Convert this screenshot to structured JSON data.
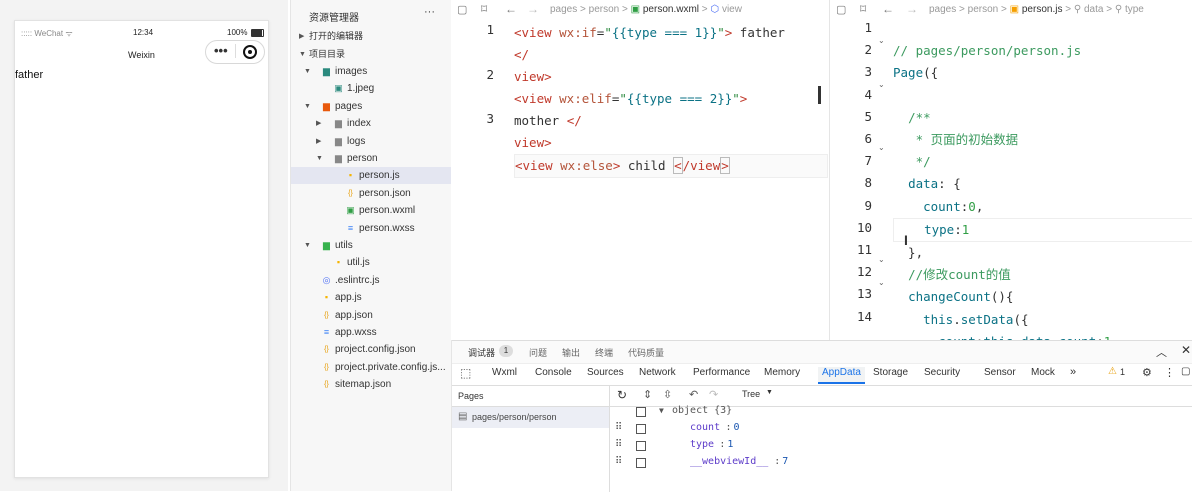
{
  "simulator": {
    "status_left": "WeChat",
    "status_time": "12:34",
    "status_battery": "100%",
    "nav_title": "Weixin",
    "page_text": "father"
  },
  "explorer": {
    "title": "资源管理器",
    "more": "···",
    "section_open": "打开的编辑器",
    "section_project": "项目目录",
    "items": [
      {
        "label": "images",
        "type": "folder",
        "depth": 1,
        "open": true
      },
      {
        "label": "1.jpeg",
        "type": "image",
        "depth": 2
      },
      {
        "label": "pages",
        "type": "folder",
        "depth": 1,
        "open": true
      },
      {
        "label": "index",
        "type": "folder",
        "depth": 2,
        "open": false
      },
      {
        "label": "logs",
        "type": "folder",
        "depth": 2,
        "open": false
      },
      {
        "label": "person",
        "type": "folder",
        "depth": 2,
        "open": true
      },
      {
        "label": "person.js",
        "type": "js",
        "depth": 3,
        "selected": true
      },
      {
        "label": "person.json",
        "type": "json",
        "depth": 3
      },
      {
        "label": "person.wxml",
        "type": "wxml",
        "depth": 3
      },
      {
        "label": "person.wxss",
        "type": "wxss",
        "depth": 3
      },
      {
        "label": "utils",
        "type": "folder",
        "depth": 1,
        "open": true
      },
      {
        "label": "util.js",
        "type": "js",
        "depth": 2
      },
      {
        "label": ".eslintrc.js",
        "type": "eslint",
        "depth": 1
      },
      {
        "label": "app.js",
        "type": "js",
        "depth": 1
      },
      {
        "label": "app.json",
        "type": "json",
        "depth": 1
      },
      {
        "label": "app.wxss",
        "type": "wxss",
        "depth": 1
      },
      {
        "label": "project.config.json",
        "type": "json",
        "depth": 1
      },
      {
        "label": "project.private.config.js...",
        "type": "json",
        "depth": 1
      },
      {
        "label": "sitemap.json",
        "type": "json",
        "depth": 1
      }
    ]
  },
  "wxml_editor": {
    "breadcrumb": [
      "pages",
      "person",
      "person.wxml",
      "view"
    ],
    "line_numbers": [
      "1",
      "2",
      "3"
    ]
  },
  "js_editor": {
    "breadcrumb": [
      "pages",
      "person",
      "person.js",
      "data",
      "type"
    ],
    "line_numbers": [
      "1",
      "2",
      "3",
      "4",
      "5",
      "6",
      "7",
      "8",
      "9",
      "10",
      "11",
      "12",
      "13",
      "14"
    ]
  },
  "devtools": {
    "top_tabs": [
      "调试器",
      "问题",
      "输出",
      "终端",
      "代码质量"
    ],
    "badge": "1",
    "tabs": [
      "Wxml",
      "Console",
      "Sources",
      "Network",
      "Performance",
      "Memory",
      "AppData",
      "Storage",
      "Security",
      "Sensor",
      "Mock"
    ],
    "active_tab": "AppData",
    "warning_count": "1",
    "pages_header": "Pages",
    "page_path": "pages/person/person",
    "view_mode": "Tree",
    "tree_root": "object {3}",
    "props": [
      {
        "key": "count",
        "value": "0"
      },
      {
        "key": "type",
        "value": "1"
      },
      {
        "key": "__webviewId__",
        "value": "7"
      }
    ]
  }
}
